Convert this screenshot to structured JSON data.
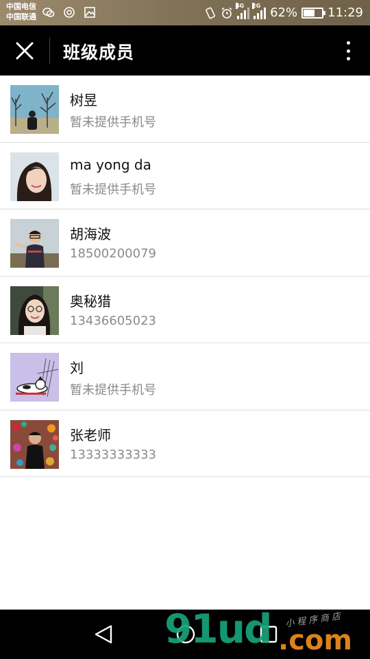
{
  "status_bar": {
    "carrier_1": "中国电信",
    "carrier_2": "中国联通",
    "network_1": "4G",
    "network_2": "2G",
    "battery_text": "62%",
    "battery_level": 0.62,
    "time": "11:29",
    "icons": [
      "wechat-icon",
      "location-icon",
      "image-icon",
      "vibrate-icon",
      "alarm-icon",
      "signal-icon",
      "battery-icon"
    ]
  },
  "header": {
    "title": "班级成员",
    "close_icon": "close-icon",
    "more_icon": "more-vertical-icon"
  },
  "members": [
    {
      "name": "树昱",
      "phone": "暂未提供手机号",
      "avatar": "avatar-trees-person"
    },
    {
      "name": "ma yong da",
      "phone": "暂未提供手机号",
      "avatar": "avatar-girl-smiling"
    },
    {
      "name": "胡海波",
      "phone": "18500200079",
      "avatar": "avatar-man-glasses"
    },
    {
      "name": "奥秘猎",
      "phone": "13436605023",
      "avatar": "avatar-woman-glasses"
    },
    {
      "name": "刘",
      "phone": "暂未提供手机号",
      "avatar": "avatar-cartoon-dog"
    },
    {
      "name": "张老师",
      "phone": "13333333333",
      "avatar": "avatar-person-colorful-wall"
    }
  ],
  "nav": {
    "back_icon": "back-triangle-icon",
    "home_icon": "home-circle-icon",
    "recent_icon": "recent-square-icon"
  },
  "watermark": {
    "main": "91ud",
    "dot": ".com",
    "sub": "小程序商店"
  },
  "colors": {
    "status_bar": "#8a7a5e",
    "title_bar": "#000000",
    "phone_text": "#8a8a8a",
    "watermark_green": "#17a37b",
    "watermark_orange": "#e8891e"
  }
}
